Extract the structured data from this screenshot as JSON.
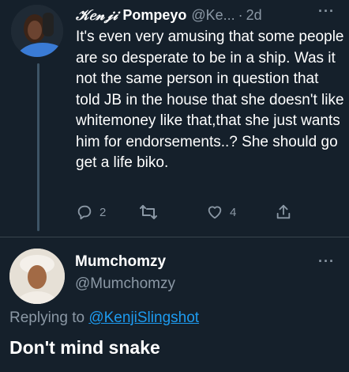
{
  "tweet": {
    "display_name_stylized": "𝒦𝑒𝓃𝒿𝒾",
    "display_name": "Pompeyo",
    "handle": "@Ke...",
    "time_sep": "·",
    "time": "2d",
    "more": "···",
    "body": "It's even very amusing that some people are so desperate to be in a ship. Was it not the same person in question that told JB in the house that she doesn't like whitemoney like that,that she just wants him for endorsements..? She should go get a life biko.",
    "actions": {
      "reply_icon": "reply-icon",
      "reply_count": "2",
      "retweet_icon": "retweet-icon",
      "like_icon": "heart-icon",
      "like_count": "4",
      "share_icon": "share-icon"
    }
  },
  "reply": {
    "display_name": "Mumchomzy",
    "handle": "@Mumchomzy",
    "more": "···",
    "replying_prefix": "Replying to ",
    "replying_to": "@KenjiSlingshot",
    "body": "Don't mind snake"
  },
  "colors": {
    "background": "#15202b",
    "text": "#ffffff",
    "muted": "#8b98a5",
    "link": "#1d9bf0",
    "divider": "#38444d"
  }
}
